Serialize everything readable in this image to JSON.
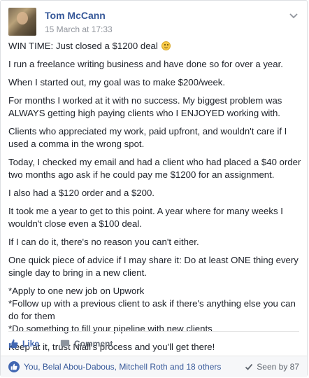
{
  "post": {
    "author": "Tom McCann",
    "timestamp": "15 March at 17:33",
    "paragraphs": [
      "WIN TIME: Just closed a $1200 deal",
      "I run a freelance writing business and have done so for over a year.",
      "When I started out, my goal was to make $200/week.",
      "For months I worked at it with no success. My biggest problem was ALWAYS getting high paying clients who I ENJOYED working with.",
      "Clients who appreciated my work, paid upfront, and wouldn't care if I used a comma in the wrong spot.",
      "Today, I checked my email and had a client who had placed a $40 order two months ago ask if he could pay me $1200 for an assignment.",
      "I also had a $120 order and a $200.",
      "It took me a year to get to this point. A year where for many weeks I wouldn't close even a $100 deal.",
      "If I can do it, there's no reason you can't either.",
      "One quick piece of advice if I may share it: Do at least ONE thing every single day to bring in a new client.",
      "*Apply to one new job on Upwork\n*Follow up with a previous client to ask if there's anything else you can do for them\n*Do something to fill your pipeline with new clients",
      "Keep at it, trust Niall's process and you'll get there!"
    ]
  },
  "actions": {
    "like_label": "Like",
    "comment_label": "Comment"
  },
  "footer": {
    "reactions_text": "You, Belal Abou-Dabous, Mitchell Roth and 18 others",
    "seen_text": "Seen by 87"
  },
  "colors": {
    "link": "#365899",
    "like_blue": "#4267b2",
    "meta_gray": "#90949c"
  },
  "icons": {
    "emoji": "smiley-emoji-icon",
    "menu": "chevron-down-icon",
    "like": "thumbs-up-icon",
    "comment": "comment-icon",
    "seen": "checkmark-icon"
  }
}
